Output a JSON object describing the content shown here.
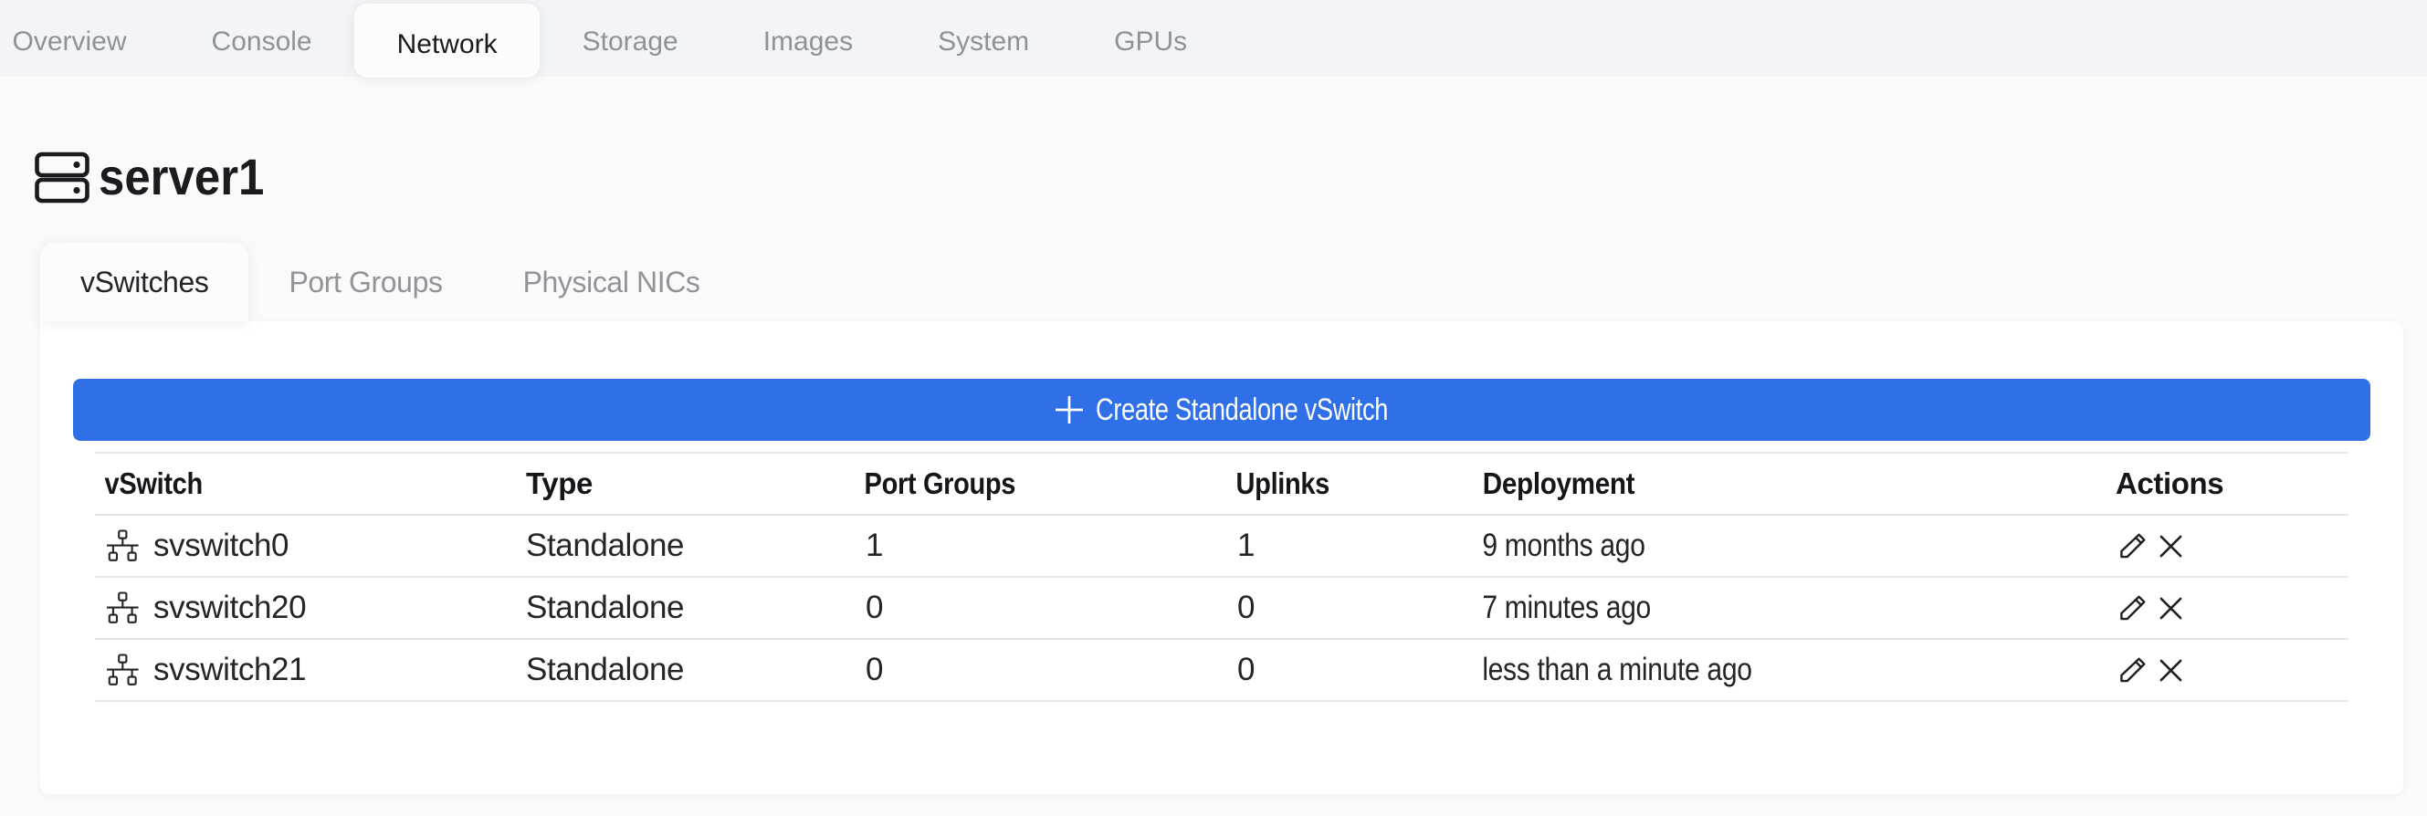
{
  "primary_tabs": {
    "items": [
      {
        "label": "Overview",
        "active": false
      },
      {
        "label": "Console",
        "active": false
      },
      {
        "label": "Network",
        "active": true
      },
      {
        "label": "Storage",
        "active": false
      },
      {
        "label": "Images",
        "active": false
      },
      {
        "label": "System",
        "active": false
      },
      {
        "label": "GPUs",
        "active": false
      }
    ]
  },
  "page": {
    "title": "server1",
    "title_icon": "server-icon"
  },
  "subtabs": {
    "items": [
      {
        "label": "vSwitches",
        "active": true
      },
      {
        "label": "Port Groups",
        "active": false
      },
      {
        "label": "Physical NICs",
        "active": false
      }
    ]
  },
  "toolbar": {
    "create_button": {
      "label": "Create Standalone vSwitch",
      "icon": "plus-icon"
    }
  },
  "table": {
    "columns": {
      "vswitch": "vSwitch",
      "type": "Type",
      "port_groups": "Port Groups",
      "uplinks": "Uplinks",
      "deployment": "Deployment",
      "actions": "Actions"
    },
    "rows": [
      {
        "name": "svswitch0",
        "type": "Standalone",
        "port_groups": "1",
        "uplinks": "1",
        "deployment": "9 months ago"
      },
      {
        "name": "svswitch20",
        "type": "Standalone",
        "port_groups": "0",
        "uplinks": "0",
        "deployment": "7 minutes ago"
      },
      {
        "name": "svswitch21",
        "type": "Standalone",
        "port_groups": "0",
        "uplinks": "0",
        "deployment": "less than a minute ago"
      }
    ],
    "row_actions": [
      "edit",
      "delete"
    ]
  },
  "colors": {
    "accent": "#2f70e9",
    "topbar_bg": "#f2f4f8",
    "page_bg": "#fafafa",
    "panel_bg": "#ffffff",
    "divider": "#e5e6e9",
    "muted_text": "#8f9296",
    "text": "#1a1b1e"
  }
}
